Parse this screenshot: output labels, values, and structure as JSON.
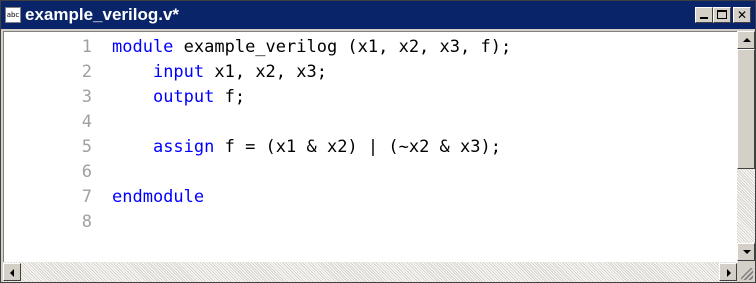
{
  "window": {
    "title": "example_verilog.v*",
    "app_icon_text": "abc"
  },
  "editor": {
    "lines": [
      {
        "num": "1",
        "tokens": [
          {
            "t": "module",
            "k": true
          },
          {
            "t": " example_verilog (x1, x2, x3, f);",
            "k": false
          }
        ]
      },
      {
        "num": "2",
        "tokens": [
          {
            "t": "    ",
            "k": false
          },
          {
            "t": "input",
            "k": true
          },
          {
            "t": " x1, x2, x3;",
            "k": false
          }
        ]
      },
      {
        "num": "3",
        "tokens": [
          {
            "t": "    ",
            "k": false
          },
          {
            "t": "output",
            "k": true
          },
          {
            "t": " f;",
            "k": false
          }
        ]
      },
      {
        "num": "4",
        "tokens": []
      },
      {
        "num": "5",
        "tokens": [
          {
            "t": "    ",
            "k": false
          },
          {
            "t": "assign",
            "k": true
          },
          {
            "t": " f = (x1 & x2) | (~x2 & x3);",
            "k": false
          }
        ]
      },
      {
        "num": "6",
        "tokens": []
      },
      {
        "num": "7",
        "tokens": [
          {
            "t": "endmodule",
            "k": true
          }
        ]
      },
      {
        "num": "8",
        "tokens": []
      }
    ]
  },
  "colors": {
    "titlebar": "#0a246a",
    "keyword": "#0000ff",
    "line_number": "#a0a0a0",
    "text": "#000000"
  }
}
